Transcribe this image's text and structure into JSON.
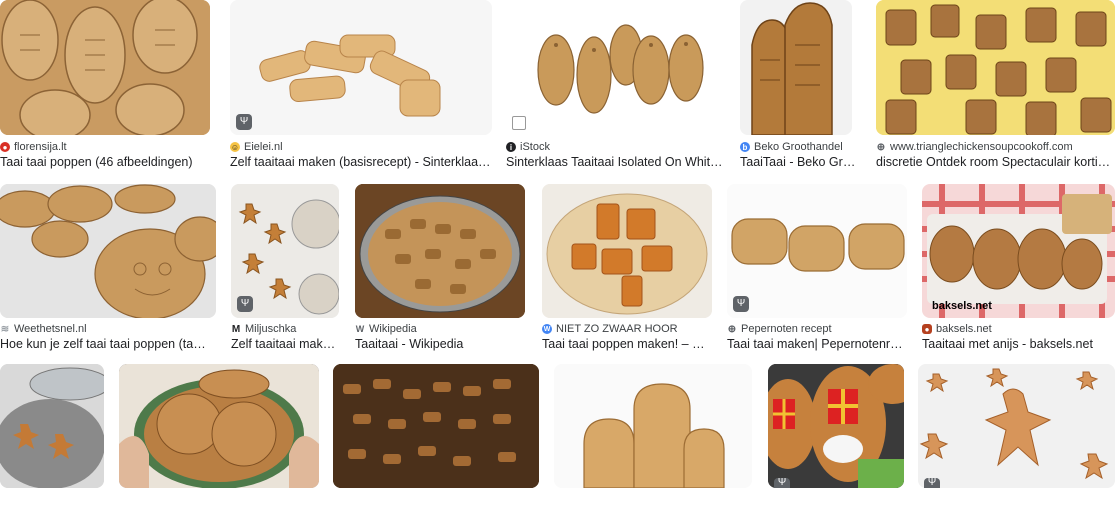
{
  "row1": [
    {
      "source": "florensija.lt",
      "title": "Taai taai poppen (46 afbeeldingen)",
      "fav_color": "#d93025",
      "fav": "●"
    },
    {
      "source": "Eielei.nl",
      "title": "Zelf taaitaai maken (basisrecept) - Sinterklaasrecept",
      "fav_color": "#f6c344",
      "fav": "☺"
    },
    {
      "source": "iStock",
      "title": "Sinterklaas Taaitaai Isolated On White Background",
      "fav_color": "#202124",
      "fav": "i"
    },
    {
      "source": "Beko Groothandel",
      "title": "TaaiTaai - Beko Groothandel",
      "fav_color": "#4285f4",
      "fav": "b"
    },
    {
      "source": "www.trianglechickensoupcookoff.com",
      "title": "discretie Ontdek room Spectaculair korting vaak",
      "fav_color": "#5f6368",
      "fav": "⊕"
    }
  ],
  "row2": [
    {
      "source": "Weethetsnel.nl",
      "title": "Hoe kun je zelf taai taai poppen (taaitaai) bakken",
      "fav_color": "#9aa0a6",
      "fav": "≋"
    },
    {
      "source": "Miljuschka",
      "title": "Zelf taaitaai maken ...",
      "fav_color": "#202124",
      "fav": "M"
    },
    {
      "source": "Wikipedia",
      "title": "Taaitaai - Wikipedia",
      "fav_color": "#5f6368",
      "fav": "W"
    },
    {
      "source": "NIET ZO ZWAAR HOOR",
      "title": "Taai taai poppen maken! – NIET ZO ZWAAR HOOR",
      "fav_color": "#4285f4",
      "fav": "W"
    },
    {
      "source": "Pepernoten recept",
      "title": "Taai taai maken| Pepernotenrecept",
      "fav_color": "#5f6368",
      "fav": "⊕"
    },
    {
      "source": "baksels.net",
      "title": "Taaitaai met anijs - baksels.net",
      "fav_color": "#b5401f",
      "fav": "●"
    }
  ],
  "watermark": "baksels.net",
  "badge_icon": "fork-knife-icon",
  "badge_glyph": "Ψ"
}
